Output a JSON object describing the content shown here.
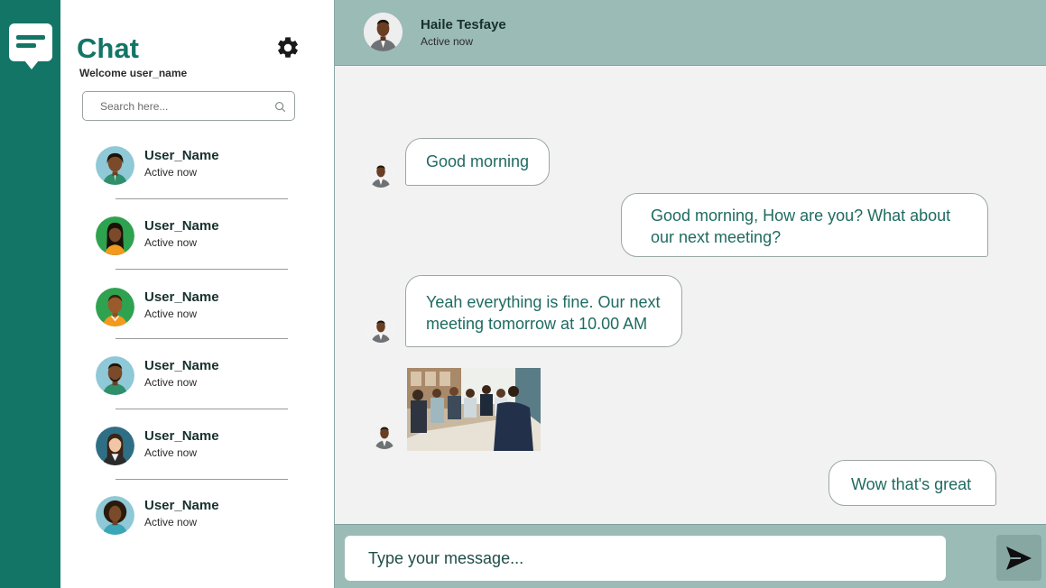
{
  "app": {
    "title": "Chat",
    "welcome": "Welcome user_name"
  },
  "search": {
    "placeholder": "Search here..."
  },
  "contacts": [
    {
      "name": "User_Name",
      "status": "Active now",
      "avatar": "avatar-woman-1"
    },
    {
      "name": "User_Name",
      "status": "Active now",
      "avatar": "avatar-woman-2"
    },
    {
      "name": "User_Name",
      "status": "Active now",
      "avatar": "avatar-man-1"
    },
    {
      "name": "User_Name",
      "status": "Active now",
      "avatar": "avatar-man-2"
    },
    {
      "name": "User_Name",
      "status": "Active now",
      "avatar": "avatar-woman-3"
    },
    {
      "name": "User_Name",
      "status": "Active now",
      "avatar": "avatar-woman-4"
    }
  ],
  "chat_header": {
    "name": "Haile Tesfaye",
    "status": "Active now"
  },
  "messages": [
    {
      "direction": "incoming",
      "type": "text",
      "text": "Good morning"
    },
    {
      "direction": "outgoing",
      "type": "text",
      "lines": [
        "Good morning, How are you? What about",
        "our next meeting?"
      ]
    },
    {
      "direction": "incoming",
      "type": "text",
      "lines": [
        "Yeah everything is fine. Our next",
        "meeting tomorrow at 10.00 AM"
      ]
    },
    {
      "direction": "incoming",
      "type": "image",
      "image": "meeting-photo"
    },
    {
      "direction": "outgoing",
      "type": "text",
      "text": "Wow that's great"
    }
  ],
  "composer": {
    "placeholder": "Type your message..."
  },
  "colors": {
    "brand": "#137565",
    "header": "#9bbbb7",
    "chat_bg": "#f2f2f2",
    "bubble_text": "#1f6b61"
  },
  "icons": {
    "logo": "chat-bubble-icon",
    "settings": "gear-icon",
    "search": "search-icon",
    "send": "send-icon"
  }
}
